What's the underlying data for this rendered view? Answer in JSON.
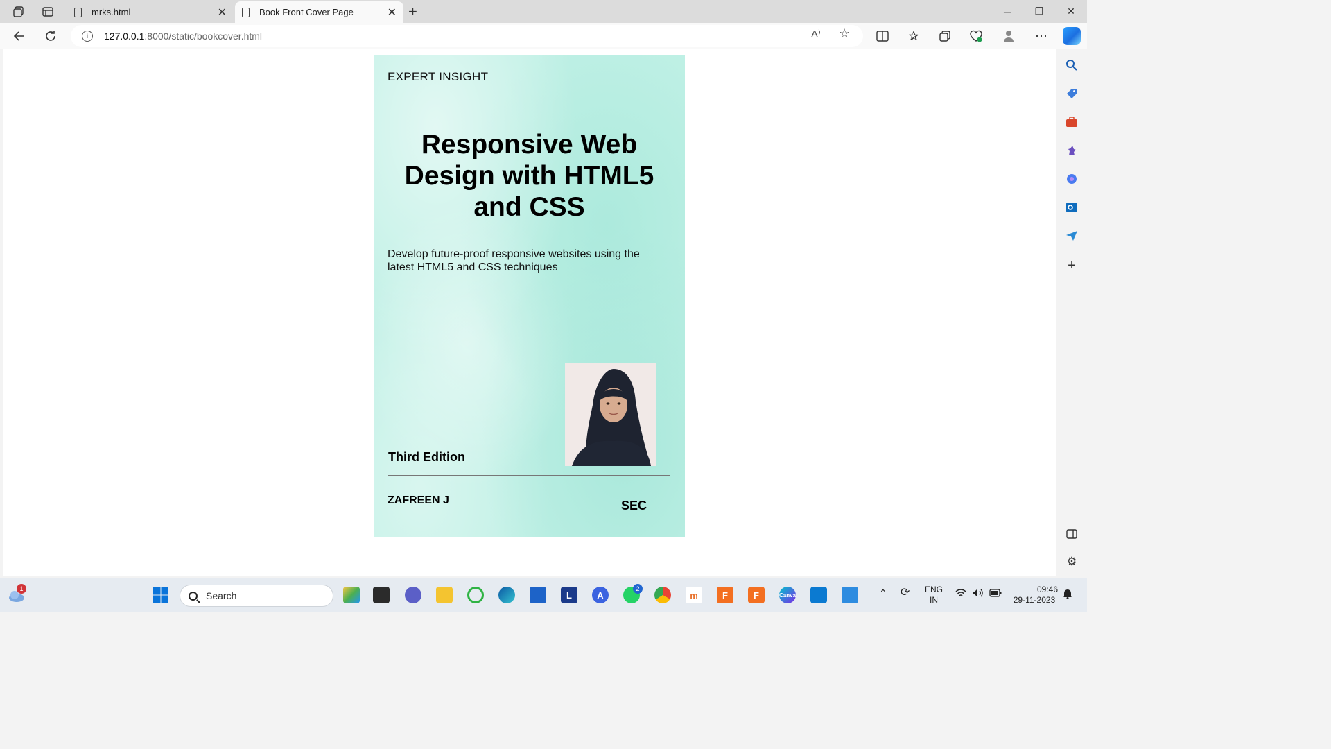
{
  "browser": {
    "tabs": [
      {
        "title": "mrks.html",
        "active": false
      },
      {
        "title": "Book Front Cover Page",
        "active": true
      }
    ],
    "url_host": "127.0.0.1",
    "url_path": ":8000/static/bookcover.html",
    "read_aloud_label": "A⁾"
  },
  "cover": {
    "series": "EXPERT INSIGHT",
    "title": "Responsive Web Design with HTML5 and CSS",
    "subtitle": "Develop future-proof responsive websites using the latest HTML5 and CSS techniques",
    "edition": "Third Edition",
    "author": "ZAFREEN J",
    "publisher": "SEC",
    "background_color": "#bff0e5"
  },
  "taskbar": {
    "search_placeholder": "Search",
    "weather_badge": "1",
    "whatsapp_badge": "2",
    "language": "ENG",
    "region": "IN",
    "time": "09:46",
    "date": "29-11-2023"
  }
}
